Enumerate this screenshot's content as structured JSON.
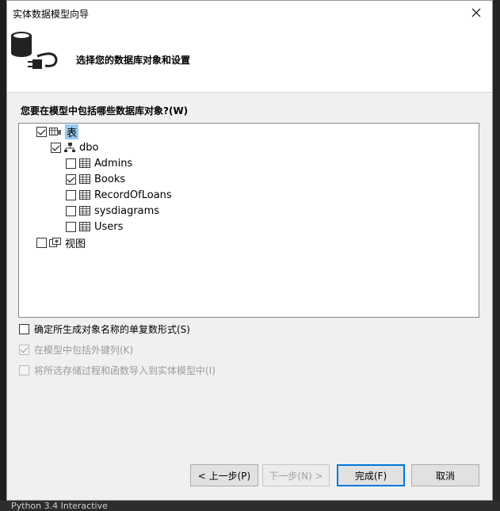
{
  "background": {
    "bottom_text": "Python 3.4 Interactive"
  },
  "dialog": {
    "title": "实体数据模型向导",
    "header_title": "选择您的数据库对象和设置",
    "prompt": "您要在模型中包括哪些数据库对象?(W)"
  },
  "tree": {
    "tables_label": "表",
    "schema_label": "dbo",
    "tables": [
      {
        "name": "Admins",
        "checked": false
      },
      {
        "name": "Books",
        "checked": true
      },
      {
        "name": "RecordOfLoans",
        "checked": false
      },
      {
        "name": "sysdiagrams",
        "checked": false
      },
      {
        "name": "Users",
        "checked": false
      }
    ],
    "views_label": "视图"
  },
  "options": {
    "pluralize": "确定所生成对象名称的单复数形式(S)",
    "foreign_keys": "在模型中包括外键列(K)",
    "import_procs": "将所选存储过程和函数导入到实体模型中(I)"
  },
  "buttons": {
    "back": "< 上一步(P)",
    "next": "下一步(N) >",
    "finish": "完成(F)",
    "cancel": "取消"
  },
  "colors": {
    "accent": "#0078d7",
    "selection": "#99c9ef"
  }
}
